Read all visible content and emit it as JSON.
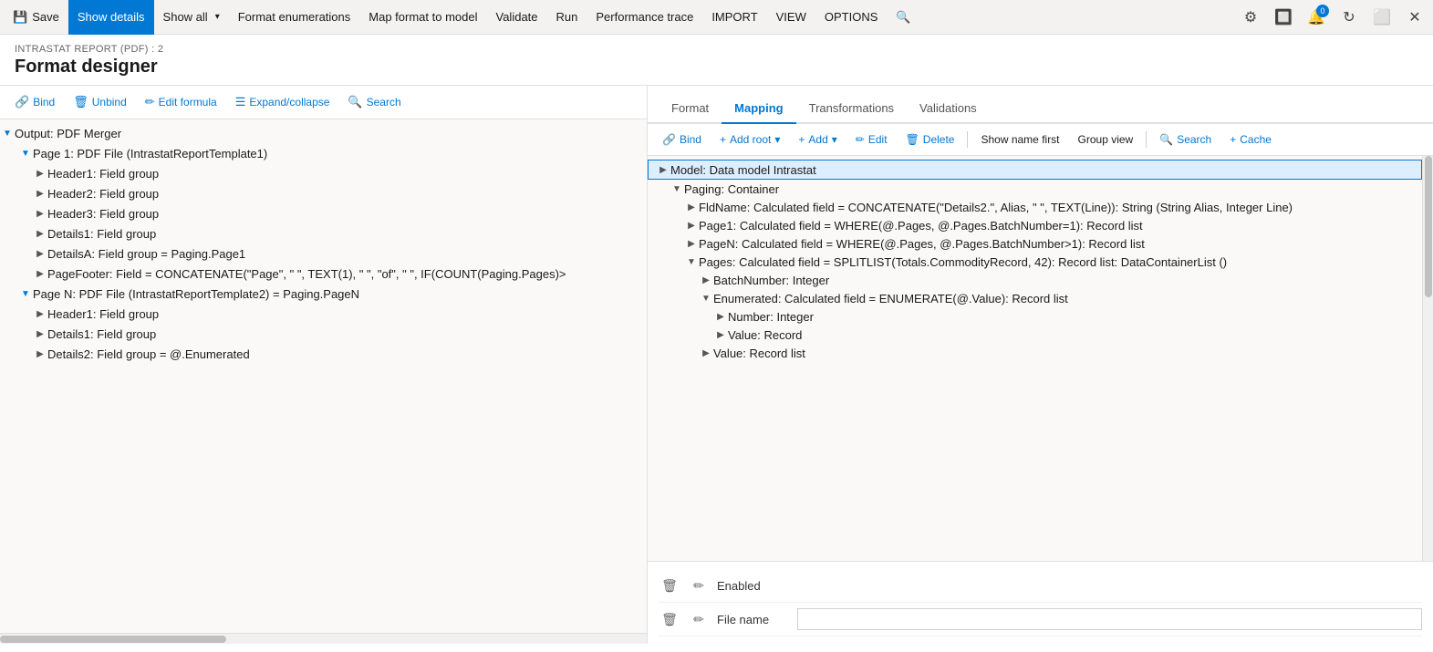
{
  "toolbar": {
    "save_label": "Save",
    "show_details_label": "Show details",
    "show_all_label": "Show all",
    "format_enumerations_label": "Format enumerations",
    "map_format_to_model_label": "Map format to model",
    "validate_label": "Validate",
    "run_label": "Run",
    "performance_trace_label": "Performance trace",
    "import_label": "IMPORT",
    "view_label": "VIEW",
    "options_label": "OPTIONS"
  },
  "breadcrumb": "INTRASTAT REPORT (PDF) : 2",
  "page_title": "Format designer",
  "left_toolbar": {
    "bind_label": "Bind",
    "unbind_label": "Unbind",
    "edit_formula_label": "Edit formula",
    "expand_collapse_label": "Expand/collapse",
    "search_label": "Search"
  },
  "tree_items": [
    {
      "id": "output",
      "label": "Output: PDF Merger",
      "level": 0,
      "expanded": true,
      "selected": false
    },
    {
      "id": "page1",
      "label": "Page 1: PDF File (IntrastatReportTemplate1)",
      "level": 1,
      "expanded": true,
      "selected": false
    },
    {
      "id": "header1",
      "label": "Header1: Field group",
      "level": 2,
      "expanded": false,
      "selected": false
    },
    {
      "id": "header2",
      "label": "Header2: Field group",
      "level": 2,
      "expanded": false,
      "selected": false
    },
    {
      "id": "header3",
      "label": "Header3: Field group",
      "level": 2,
      "expanded": false,
      "selected": false
    },
    {
      "id": "details1",
      "label": "Details1: Field group",
      "level": 2,
      "expanded": false,
      "selected": false
    },
    {
      "id": "detailsA",
      "label": "DetailsA: Field group = Paging.Page1",
      "level": 2,
      "expanded": false,
      "selected": false
    },
    {
      "id": "pagefooter",
      "label": "PageFooter: Field = CONCATENATE(\"Page\", \" \", TEXT(1), \" \", \"of\", \" \", IF(COUNT(Paging.Pages)>",
      "level": 2,
      "expanded": false,
      "selected": false
    },
    {
      "id": "pageN",
      "label": "Page N: PDF File (IntrastatReportTemplate2) = Paging.PageN",
      "level": 1,
      "expanded": true,
      "selected": false
    },
    {
      "id": "header1b",
      "label": "Header1: Field group",
      "level": 2,
      "expanded": false,
      "selected": false
    },
    {
      "id": "details1b",
      "label": "Details1: Field group",
      "level": 2,
      "expanded": false,
      "selected": false
    },
    {
      "id": "details2b",
      "label": "Details2: Field group = @.Enumerated",
      "level": 2,
      "expanded": false,
      "selected": false
    }
  ],
  "tabs": [
    {
      "id": "format",
      "label": "Format"
    },
    {
      "id": "mapping",
      "label": "Mapping"
    },
    {
      "id": "transformations",
      "label": "Transformations"
    },
    {
      "id": "validations",
      "label": "Validations"
    }
  ],
  "active_tab": "mapping",
  "right_toolbar": {
    "bind_label": "Bind",
    "add_root_label": "Add root",
    "add_label": "Add",
    "edit_label": "Edit",
    "delete_label": "Delete",
    "show_name_first_label": "Show name first",
    "group_view_label": "Group view",
    "search_label": "Search",
    "cache_label": "Cache"
  },
  "model_items": [
    {
      "id": "model_root",
      "label": "Model: Data model Intrastat",
      "level": 0,
      "expanded": false,
      "highlighted": true
    },
    {
      "id": "paging",
      "label": "Paging: Container",
      "level": 1,
      "expanded": true
    },
    {
      "id": "fldname",
      "label": "FldName: Calculated field = CONCATENATE(\"Details2.\", Alias, \" \", TEXT(Line)): String (String Alias, Integer Line)",
      "level": 2,
      "expanded": false
    },
    {
      "id": "page1_model",
      "label": "Page1: Calculated field = WHERE(@.Pages, @.Pages.BatchNumber=1): Record list",
      "level": 2,
      "expanded": false
    },
    {
      "id": "pageN_model",
      "label": "PageN: Calculated field = WHERE(@.Pages, @.Pages.BatchNumber>1): Record list",
      "level": 2,
      "expanded": false
    },
    {
      "id": "pages",
      "label": "Pages: Calculated field = SPLITLIST(Totals.CommodityRecord, 42): Record list: DataContainerList ()",
      "level": 2,
      "expanded": true
    },
    {
      "id": "batchnumber",
      "label": "BatchNumber: Integer",
      "level": 3,
      "expanded": false
    },
    {
      "id": "enumerated",
      "label": "Enumerated: Calculated field = ENUMERATE(@.Value): Record list",
      "level": 3,
      "expanded": true
    },
    {
      "id": "number",
      "label": "Number: Integer",
      "level": 4,
      "expanded": false
    },
    {
      "id": "value_record",
      "label": "Value: Record",
      "level": 4,
      "expanded": false
    },
    {
      "id": "value_list",
      "label": "Value: Record list",
      "level": 3,
      "expanded": false
    }
  ],
  "bottom_fields": [
    {
      "id": "enabled",
      "label": "Enabled"
    },
    {
      "id": "filename",
      "label": "File name"
    }
  ]
}
